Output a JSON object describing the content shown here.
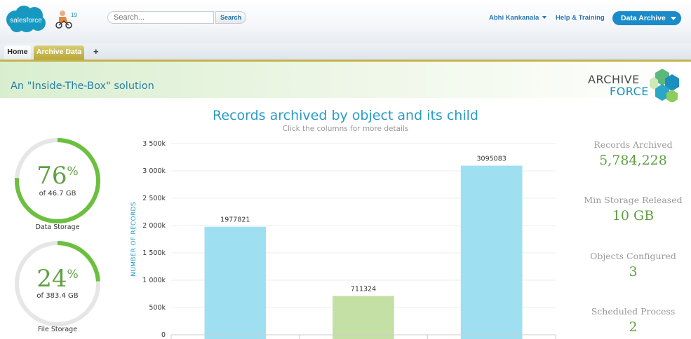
{
  "header": {
    "logo_text": "salesforce",
    "release_badge": "19",
    "search": {
      "placeholder": "Search...",
      "button_label": "Search"
    },
    "user_name": "Abhi Kankanala",
    "help_label": "Help & Training",
    "app_menu_label": "Data Archive"
  },
  "tabs": [
    {
      "label": "Home",
      "active": false
    },
    {
      "label": "Archive Data",
      "active": true
    }
  ],
  "add_tab_label": "+",
  "banner": {
    "tagline": "An \"Inside-The-Box\" solution",
    "logo_line1": "ARCHIVE",
    "logo_line2": "FORCE"
  },
  "gauges": [
    {
      "value": "76",
      "unit": "%",
      "fraction": 0.76,
      "subtitle": "of 46.7 GB",
      "caption": "Data Storage"
    },
    {
      "value": "24",
      "unit": "%",
      "fraction": 0.24,
      "subtitle": "of 383.4 GB",
      "caption": "File Storage"
    }
  ],
  "chart_title": "Records archived by object and its child",
  "chart_subtitle": "Click the columns for more details",
  "chart_data": {
    "type": "bar",
    "title": "Records archived by object and its child",
    "subtitle": "Click the columns for more details",
    "ylabel": "NUMBER OF RECORDS",
    "xlabel": "",
    "ylim": [
      0,
      3500000
    ],
    "yticks": [
      0,
      500000,
      1000000,
      1500000,
      2000000,
      2500000,
      3000000,
      3500000
    ],
    "ytick_labels": [
      "0",
      "500k",
      "1 000k",
      "1 500k",
      "2 000k",
      "2 500k",
      "3 000k",
      "3 500k"
    ],
    "values": [
      1977821,
      711324,
      3095083
    ],
    "value_labels": [
      "1977821",
      "711324",
      "3095083"
    ],
    "colors": [
      "#9fdff2",
      "#c4e0a4",
      "#9fdff2"
    ],
    "grid": true
  },
  "stats": [
    {
      "label": "Records Archived",
      "value": "5,784,228"
    },
    {
      "label": "Min Storage Released",
      "value": "10 GB"
    },
    {
      "label": "Objects Configured",
      "value": "3"
    },
    {
      "label": "Scheduled Process",
      "value": "2"
    }
  ],
  "colors": {
    "accent_blue": "#1a8bc8",
    "tab_gold": "#c4b24d",
    "gauge_green": "#6cbf3f",
    "stat_green": "#5fa043",
    "title_blue": "#2a9bc4"
  }
}
